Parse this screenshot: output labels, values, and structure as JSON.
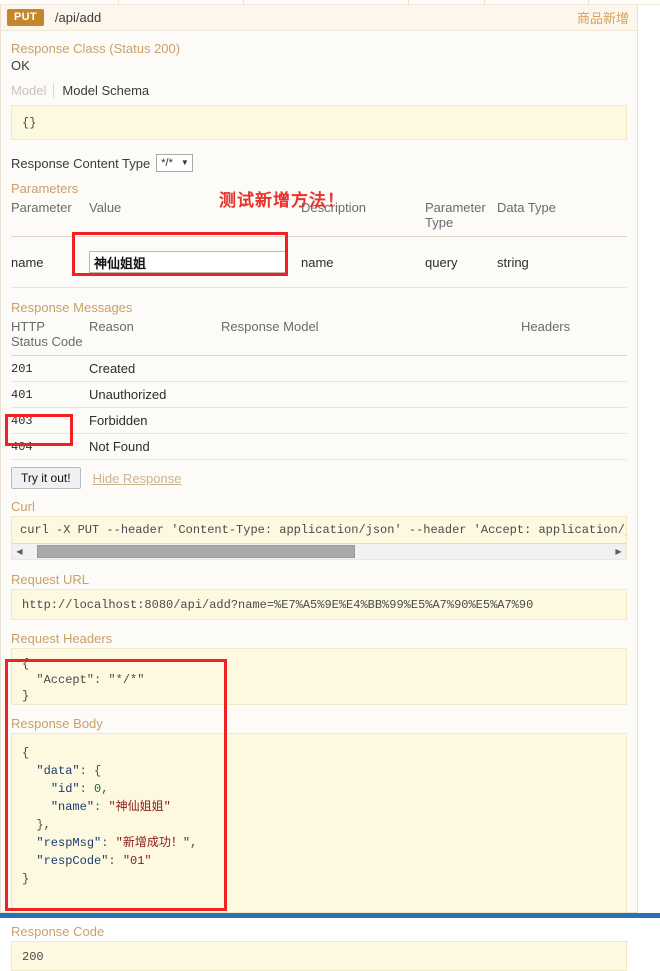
{
  "operation": {
    "method": "PUT",
    "path": "/api/add",
    "summary": "商品新增"
  },
  "response_class": {
    "title": "Response Class (Status 200)",
    "status_text": "OK",
    "tab_model": "Model",
    "tab_model_schema": "Model Schema",
    "signature": "{}"
  },
  "response_content_type": {
    "label": "Response Content Type",
    "value": "*/*",
    "caret": "▼"
  },
  "parameters": {
    "title": "Parameters",
    "headers": [
      "Parameter",
      "Value",
      "Description",
      "Parameter Type",
      "Data Type"
    ],
    "rows": [
      {
        "parameter": "name",
        "value": "神仙姐姐",
        "description": "name",
        "parameter_type": "query",
        "data_type": "string"
      }
    ]
  },
  "response_messages": {
    "title": "Response Messages",
    "headers": [
      "HTTP Status Code",
      "Reason",
      "Response Model",
      "Headers"
    ],
    "rows": [
      {
        "code": "201",
        "reason": "Created",
        "model": "",
        "headers": ""
      },
      {
        "code": "401",
        "reason": "Unauthorized",
        "model": "",
        "headers": ""
      },
      {
        "code": "403",
        "reason": "Forbidden",
        "model": "",
        "headers": ""
      },
      {
        "code": "404",
        "reason": "Not Found",
        "model": "",
        "headers": ""
      }
    ]
  },
  "actions": {
    "try_it_out": "Try it out!",
    "hide_response": "Hide Response"
  },
  "curl": {
    "title": "Curl",
    "command": "curl -X PUT --header 'Content-Type: application/json' --header 'Accept: application/json",
    "scroll_left_arrow": "◀",
    "scroll_right_arrow": "▶"
  },
  "request_url": {
    "title": "Request URL",
    "url": "http://localhost:8080/api/add?name=%E7%A5%9E%E4%BB%99%E5%A7%90%E5%A7%90"
  },
  "request_headers": {
    "title": "Request Headers",
    "body_line_1": "{",
    "body_line_2": "  \"Accept\": \"*/*\"",
    "body_line_3": "}"
  },
  "response_body": {
    "title": "Response Body",
    "lines": [
      {
        "indent": 0,
        "parts": [
          {
            "t": "{",
            "c": "j-pun"
          }
        ]
      },
      {
        "indent": 1,
        "parts": [
          {
            "t": "\"data\"",
            "c": "j-key"
          },
          {
            "t": ": {",
            "c": "j-pun"
          }
        ]
      },
      {
        "indent": 2,
        "parts": [
          {
            "t": "\"id\"",
            "c": "j-key"
          },
          {
            "t": ": ",
            "c": "j-pun"
          },
          {
            "t": "0",
            "c": "j-num"
          },
          {
            "t": ",",
            "c": "j-pun"
          }
        ]
      },
      {
        "indent": 2,
        "parts": [
          {
            "t": "\"name\"",
            "c": "j-key"
          },
          {
            "t": ": ",
            "c": "j-pun"
          },
          {
            "t": "\"神仙姐姐\"",
            "c": "j-str"
          }
        ]
      },
      {
        "indent": 1,
        "parts": [
          {
            "t": "},",
            "c": "j-pun"
          }
        ]
      },
      {
        "indent": 1,
        "parts": [
          {
            "t": "\"respMsg\"",
            "c": "j-key"
          },
          {
            "t": ": ",
            "c": "j-pun"
          },
          {
            "t": "\"新增成功！\"",
            "c": "j-str"
          },
          {
            "t": ",",
            "c": "j-pun"
          }
        ]
      },
      {
        "indent": 1,
        "parts": [
          {
            "t": "\"respCode\"",
            "c": "j-key"
          },
          {
            "t": ": ",
            "c": "j-pun"
          },
          {
            "t": "\"01\"",
            "c": "j-str"
          }
        ]
      },
      {
        "indent": 0,
        "parts": [
          {
            "t": "}",
            "c": "j-pun"
          }
        ]
      }
    ]
  },
  "response_code": {
    "title": "Response Code",
    "value": "200"
  },
  "annotations": {
    "note_text": "测试新增方法！",
    "colors": {
      "red": "#ee2222",
      "accent": "#c5862b",
      "section": "#c8a06a"
    }
  }
}
